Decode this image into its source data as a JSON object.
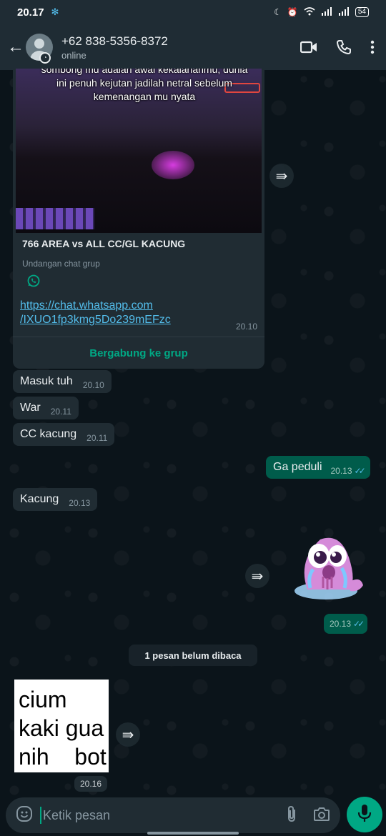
{
  "statusbar": {
    "time": "20.17",
    "battery": "54"
  },
  "header": {
    "contact_name": "+62 838-5356-8372",
    "presence": "online"
  },
  "link_card": {
    "thumbnail_caption": "sombong mu adalah awal kekalahanmu, dunia ini penuh kejutan jadilah netral sebelum kemenangan mu nyata",
    "title": "766 AREA vs ALL CC/GL KACUNG",
    "subtitle": "Undangan chat grup",
    "link_line1": "https://chat.whatsapp.com",
    "link_line2": "/IXUO1fp3kmg5Do239mEFzc",
    "time": "20.10",
    "action_label": "Bergabung ke grup"
  },
  "messages": [
    {
      "direction": "in",
      "text": "Masuk tuh",
      "time": "20.10"
    },
    {
      "direction": "in",
      "text": "War",
      "time": "20.11"
    },
    {
      "direction": "in",
      "text": "CC kacung",
      "time": "20.11"
    },
    {
      "direction": "out",
      "text": "Ga peduli",
      "time": "20.13",
      "status": "read"
    },
    {
      "direction": "in",
      "text": "Kacung",
      "time": "20.13"
    }
  ],
  "sticker_message": {
    "time": "20.13",
    "status": "read"
  },
  "unread_divider": "1 pesan belum dibaca",
  "image_message": {
    "lines": [
      "cium",
      "kaki gua",
      "nih    bot"
    ],
    "time": "20.16"
  },
  "composer": {
    "placeholder": "Ketik pesan"
  },
  "colors": {
    "accent": "#00a884",
    "outgoing_bubble": "#005c4b",
    "incoming_bubble": "#202c33",
    "read_ticks": "#53bdeb"
  }
}
